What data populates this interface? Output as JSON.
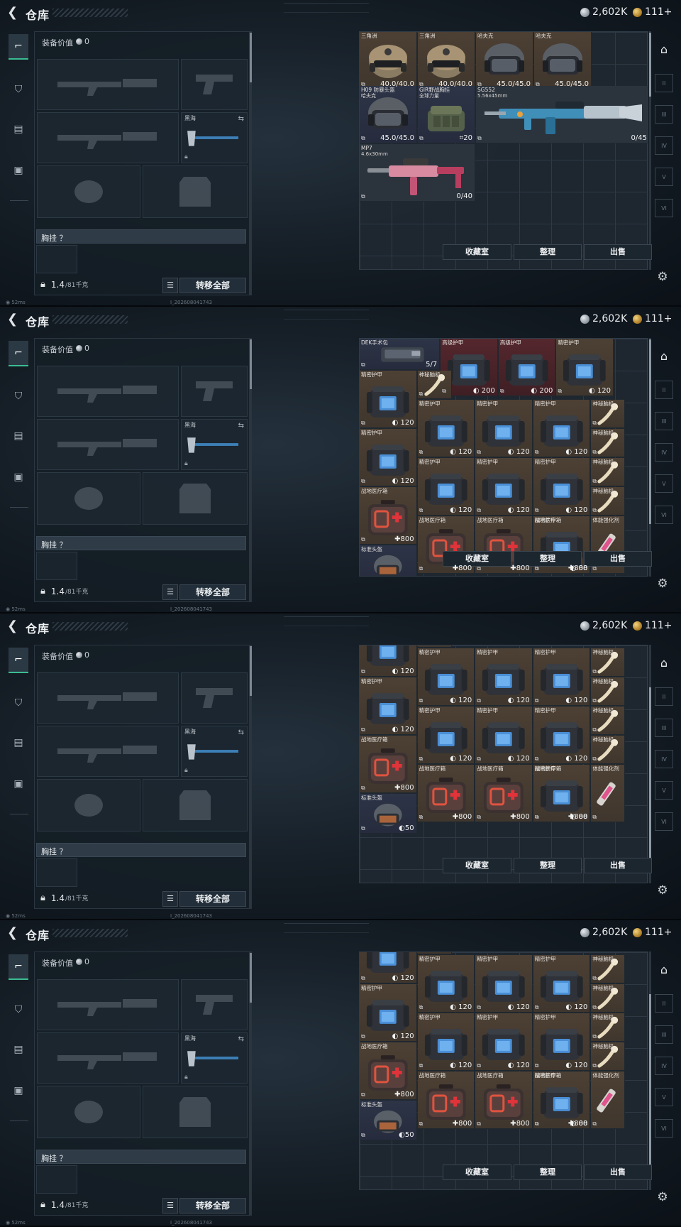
{
  "header": {
    "title": "仓库",
    "silver": "2,602K",
    "gold": "111+"
  },
  "equipment": {
    "title": "装备价值",
    "value": "0",
    "slot_label": "黑海",
    "chest_label": "胸挂 ？",
    "weight": "1.4",
    "weight_max": "/81千克",
    "move_all": "转移全部"
  },
  "stash_buttons": {
    "collection": "收藏室",
    "sort": "整理",
    "sell": "出售"
  },
  "status": {
    "ping": "52ms",
    "build": "I_202608041743"
  },
  "icons": {
    "back": "back-chevron-icon",
    "home": "stash-home-icon",
    "settings": "gear-icon",
    "weight": "weight-lock-icon",
    "list": "list-icon"
  },
  "colors": {
    "accent": "#3bbd92",
    "brown": "#4d4034",
    "red": "#54272d",
    "blue": "#2d3447"
  },
  "frames": [
    {
      "items": [
        {
          "id": "h1",
          "name": "三角洲",
          "sub": "",
          "val": "40.0/40.0",
          "art": "helmet-tan",
          "c": "c-brown"
        },
        {
          "id": "h2",
          "name": "三角洲",
          "sub": "",
          "val": "40.0/40.0",
          "art": "helmet-tan",
          "c": "c-brown"
        },
        {
          "id": "h3",
          "name": "哈夫克",
          "sub": "",
          "val": "45.0/45.0",
          "art": "helmet-black",
          "c": "c-brown"
        },
        {
          "id": "h4",
          "name": "哈夫克",
          "sub": "",
          "val": "45.0/45.0",
          "art": "helmet-black",
          "c": "c-brown"
        },
        {
          "id": "h5",
          "name": "H09 防暴头盔",
          "sub": "哈夫克",
          "val": "45.0/45.0",
          "art": "helmet-black",
          "c": "c-blue"
        },
        {
          "id": "v1",
          "name": "GIR野战胸挂",
          "sub": "全球力量",
          "val": "20",
          "art": "vest-green",
          "c": "c-blue"
        },
        {
          "id": "g1",
          "name": "SG552",
          "sub": "5.56x45mm",
          "val": "0/45",
          "art": "rifle-blue",
          "c": "c-dark"
        },
        {
          "id": "g2",
          "name": "MP7",
          "sub": "4.6x30mm",
          "val": "0/40",
          "art": "smg-pink",
          "c": "c-dark"
        }
      ]
    },
    {
      "items": [
        {
          "id": "dek",
          "name": "DEK手术包",
          "sub": "",
          "val": "5/7",
          "art": "kit",
          "c": "c-blue"
        },
        {
          "id": "a1",
          "name": "高级护甲",
          "sub": "",
          "val": "200",
          "art": "armor",
          "c": "c-red"
        },
        {
          "id": "a2",
          "name": "高级护甲",
          "sub": "",
          "val": "200",
          "art": "armor",
          "c": "c-red"
        },
        {
          "id": "a3",
          "name": "精密护甲",
          "sub": "",
          "val": "120",
          "art": "armor",
          "c": "c-brown"
        },
        {
          "id": "a4",
          "name": "精密护甲",
          "sub": "",
          "val": "120",
          "art": "armor",
          "c": "c-brown"
        },
        {
          "id": "s1",
          "name": "神秘脑机",
          "sub": "",
          "val": "",
          "art": "bone",
          "c": "c-brown"
        },
        {
          "id": "a5",
          "name": "精密护甲",
          "sub": "",
          "val": "120",
          "art": "armor",
          "c": "c-brown"
        },
        {
          "id": "a6",
          "name": "精密护甲",
          "sub": "",
          "val": "120",
          "art": "armor",
          "c": "c-brown"
        },
        {
          "id": "a7",
          "name": "精密护甲",
          "sub": "",
          "val": "120",
          "art": "armor",
          "c": "c-brown"
        },
        {
          "id": "a8",
          "name": "精密护甲",
          "sub": "",
          "val": "120",
          "art": "armor",
          "c": "c-brown"
        },
        {
          "id": "s2",
          "name": "神秘脑机",
          "sub": "",
          "val": "",
          "art": "bone",
          "c": "c-brown"
        },
        {
          "id": "s3",
          "name": "神秘脑机",
          "sub": "",
          "val": "",
          "art": "bone",
          "c": "c-brown"
        },
        {
          "id": "a9",
          "name": "精密护甲",
          "sub": "",
          "val": "120",
          "art": "armor",
          "c": "c-brown"
        },
        {
          "id": "a10",
          "name": "精密护甲",
          "sub": "",
          "val": "120",
          "art": "armor",
          "c": "c-brown"
        },
        {
          "id": "a11",
          "name": "精密护甲",
          "sub": "",
          "val": "120",
          "art": "armor",
          "c": "c-brown"
        },
        {
          "id": "a12",
          "name": "精密护甲",
          "sub": "",
          "val": "88",
          "art": "armor",
          "c": "c-brown"
        },
        {
          "id": "s4",
          "name": "神秘脑机",
          "sub": "",
          "val": "",
          "art": "bone",
          "c": "c-brown"
        },
        {
          "id": "s5",
          "name": "神秘脑机",
          "sub": "",
          "val": "",
          "art": "bone",
          "c": "c-brown"
        },
        {
          "id": "m1",
          "name": "战地医疗箱",
          "sub": "",
          "val": "800",
          "art": "med",
          "c": "c-brown"
        },
        {
          "id": "m2",
          "name": "战地医疗箱",
          "sub": "",
          "val": "800",
          "art": "med",
          "c": "c-brown"
        },
        {
          "id": "m3",
          "name": "战地医疗箱",
          "sub": "",
          "val": "800",
          "art": "med",
          "c": "c-brown"
        },
        {
          "id": "m4",
          "name": "战地医疗箱",
          "sub": "",
          "val": "800",
          "art": "med",
          "c": "c-brown"
        },
        {
          "id": "p1",
          "name": "体能强化剂",
          "sub": "",
          "val": "",
          "art": "syringe",
          "c": "c-brown"
        },
        {
          "id": "hb",
          "name": "标准头盔",
          "sub": "",
          "val": "50",
          "art": "helmet-small",
          "c": "c-blue"
        }
      ]
    }
  ]
}
